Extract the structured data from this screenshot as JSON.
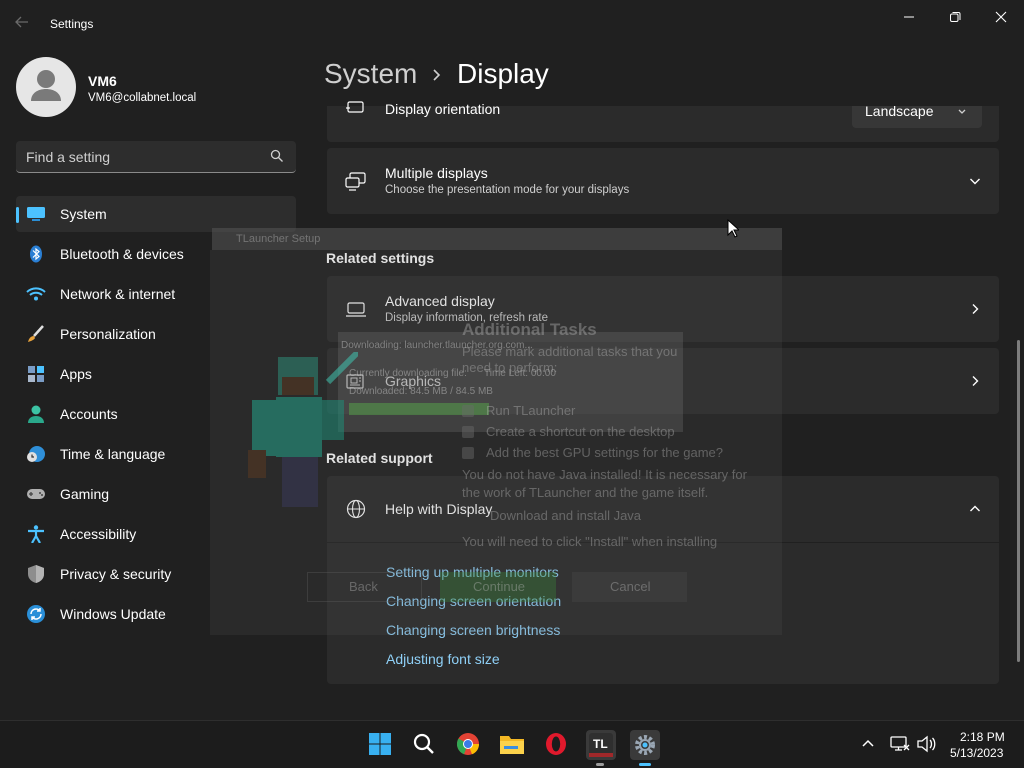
{
  "window": {
    "title": "Settings",
    "controls": [
      "minimize",
      "maximize",
      "close"
    ]
  },
  "user": {
    "name": "VM6",
    "email": "VM6@collabnet.local"
  },
  "search": {
    "placeholder": "Find a setting"
  },
  "sidebar": {
    "items": [
      {
        "label": "System",
        "icon": "monitor-icon",
        "active": true
      },
      {
        "label": "Bluetooth & devices",
        "icon": "bluetooth-icon"
      },
      {
        "label": "Network & internet",
        "icon": "wifi-icon"
      },
      {
        "label": "Personalization",
        "icon": "paintbrush-icon"
      },
      {
        "label": "Apps",
        "icon": "apps-icon"
      },
      {
        "label": "Accounts",
        "icon": "person-icon"
      },
      {
        "label": "Time & language",
        "icon": "clock-globe-icon"
      },
      {
        "label": "Gaming",
        "icon": "gamepad-icon"
      },
      {
        "label": "Accessibility",
        "icon": "accessibility-icon"
      },
      {
        "label": "Privacy & security",
        "icon": "shield-icon"
      },
      {
        "label": "Windows Update",
        "icon": "update-icon"
      }
    ]
  },
  "breadcrumb": {
    "root": "System",
    "current": "Display"
  },
  "display": {
    "orientation": {
      "title": "Display orientation",
      "value": "Landscape"
    },
    "multiple_displays": {
      "title": "Multiple displays",
      "subtitle": "Choose the presentation mode for your displays"
    }
  },
  "related_settings": {
    "header": "Related settings",
    "advanced": {
      "title": "Advanced display",
      "subtitle": "Display information, refresh rate"
    },
    "graphics": {
      "title": "Graphics"
    }
  },
  "related_support": {
    "header": "Related support",
    "help": {
      "title": "Help with Display"
    },
    "links": [
      "Setting up multiple monitors",
      "Changing screen orientation",
      "Changing screen brightness",
      "Adjusting font size"
    ]
  },
  "installer_overlay": {
    "title_bar": "TLauncher Setup",
    "heading": "Additional Tasks",
    "intro": "Please mark additional tasks that you need to perform:",
    "downloading_from": "Downloading: launcher.tlauncher.org.com...",
    "currently_downloading": "Currently downloading file:",
    "time_left": "Time Left: 00:00",
    "downloaded": "Downloaded: 84.5 MB / 84.5 MB",
    "options": [
      {
        "label": "Run TLauncher",
        "checked": true
      },
      {
        "label": "Create a shortcut on the desktop",
        "checked": true
      },
      {
        "label": "Add the best GPU settings for the game?",
        "checked": false
      }
    ],
    "java_note": "You do not have Java installed! It is necessary for the work of TLauncher and the game itself.",
    "java_option": "Download and install Java",
    "install_note": "You will need to click \"Install\" when installing",
    "buttons": {
      "back": "Back",
      "continue": "Continue",
      "cancel": "Cancel"
    }
  },
  "taskbar": {
    "apps": [
      "windows-start-icon",
      "search-icon",
      "chrome-icon",
      "file-explorer-icon",
      "opera-icon",
      "tlauncher-icon",
      "settings-icon"
    ],
    "tlauncher_label": "TL",
    "time": "2:18 PM",
    "date": "5/13/2023"
  },
  "colors": {
    "background": "#202020",
    "card": "#2b2b2b",
    "accent": "#4cc2ff",
    "link": "#8fd0f7"
  }
}
